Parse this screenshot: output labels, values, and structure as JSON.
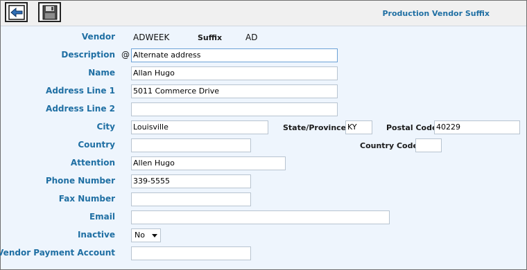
{
  "window": {
    "title": "Production Vendor Suffix"
  },
  "toolbar": {
    "back_icon": "back-arrow-icon",
    "save_icon": "save-disk-icon"
  },
  "form": {
    "vendor_label": "Vendor",
    "vendor_value": "ADWEEK",
    "suffix_label": "Suffix",
    "suffix_value": "AD",
    "description_label": "Description",
    "description_at": "@",
    "description_value": "Alternate address",
    "name_label": "Name",
    "name_value": "Allan Hugo",
    "address1_label": "Address Line 1",
    "address1_value": "5011 Commerce Drive",
    "address2_label": "Address Line 2",
    "address2_value": "",
    "city_label": "City",
    "city_value": "Louisville",
    "state_label": "State/Province",
    "state_value": "KY",
    "postal_label": "Postal Code",
    "postal_value": "40229",
    "country_label": "Country",
    "country_value": "",
    "country_code_label": "Country Code",
    "country_code_value": "",
    "attention_label": "Attention",
    "attention_value": "Allen Hugo",
    "phone_label": "Phone Number",
    "phone_value": "339-5555",
    "fax_label": "Fax Number",
    "fax_value": "",
    "email_label": "Email",
    "email_value": "",
    "inactive_label": "Inactive",
    "inactive_value": "No",
    "payment_account_label": "Vendor Payment Account",
    "payment_account_value": ""
  }
}
